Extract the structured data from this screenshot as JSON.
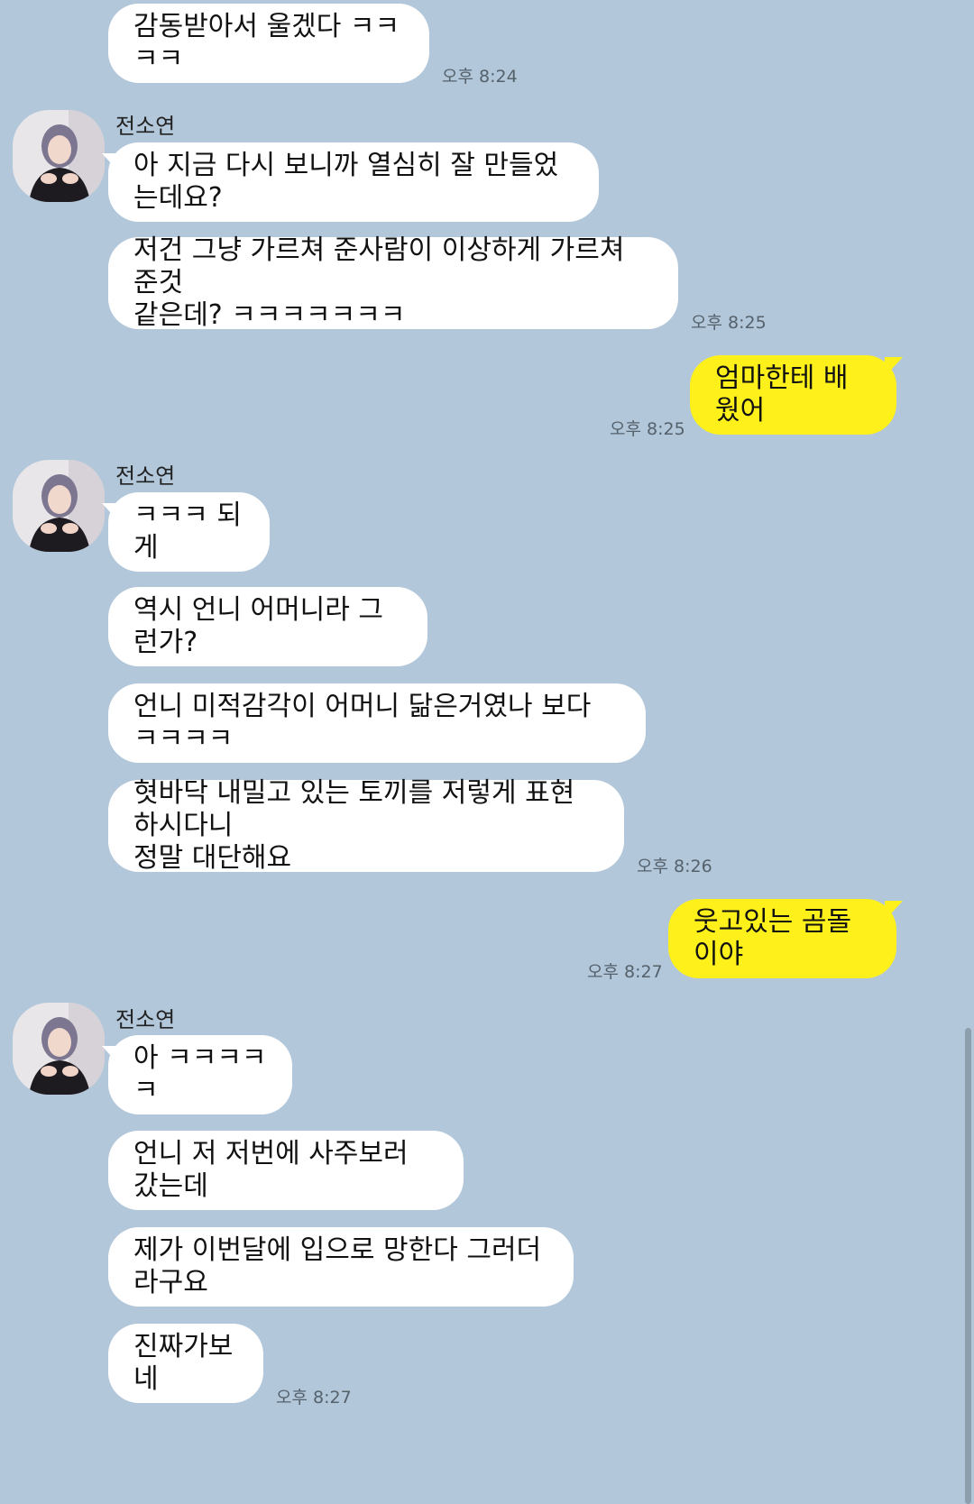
{
  "chat": {
    "contact_name": "전소연",
    "messages": {
      "m1": {
        "text": "감동받아서 울겠다 ㅋㅋㅋㅋ",
        "time": "오후 8:24"
      },
      "m2": {
        "text": "아 지금 다시 보니까 열심히 잘 만들었는데요?"
      },
      "m3": {
        "text": "저건 그냥 가르쳐 준사람이 이상하게 가르쳐 준것\n같은데? ㅋㅋㅋㅋㅋㅋㅋ",
        "time": "오후 8:25"
      },
      "m4": {
        "text": "엄마한테 배웠어",
        "time": "오후 8:25"
      },
      "m5": {
        "text": "ㅋㅋㅋ 되게"
      },
      "m6": {
        "text": "역시 언니 어머니라 그런가?"
      },
      "m7": {
        "text": "언니 미적감각이 어머니 닮은거였나 보다 ㅋㅋㅋㅋ"
      },
      "m8": {
        "text": "혓바닥 내밀고 있는 토끼를 저렇게 표현하시다니\n정말 대단해요",
        "time": "오후 8:26"
      },
      "m9": {
        "text": "웃고있는 곰돌이야",
        "time": "오후 8:27"
      },
      "m10": {
        "text": "아 ㅋㅋㅋㅋㅋ"
      },
      "m11": {
        "text": "언니 저 저번에 사주보러 갔는데"
      },
      "m12": {
        "text": "제가 이번달에 입으로 망한다 그러더라구요"
      },
      "m13": {
        "text": "진짜가보네",
        "time": "오후 8:27"
      }
    }
  },
  "colors": {
    "background": "#b2c7da",
    "received_bubble": "#ffffff",
    "sent_bubble": "#fef01b",
    "timestamp": "#55616b"
  },
  "icons": {
    "avatar": "profile-photo-avatar"
  }
}
